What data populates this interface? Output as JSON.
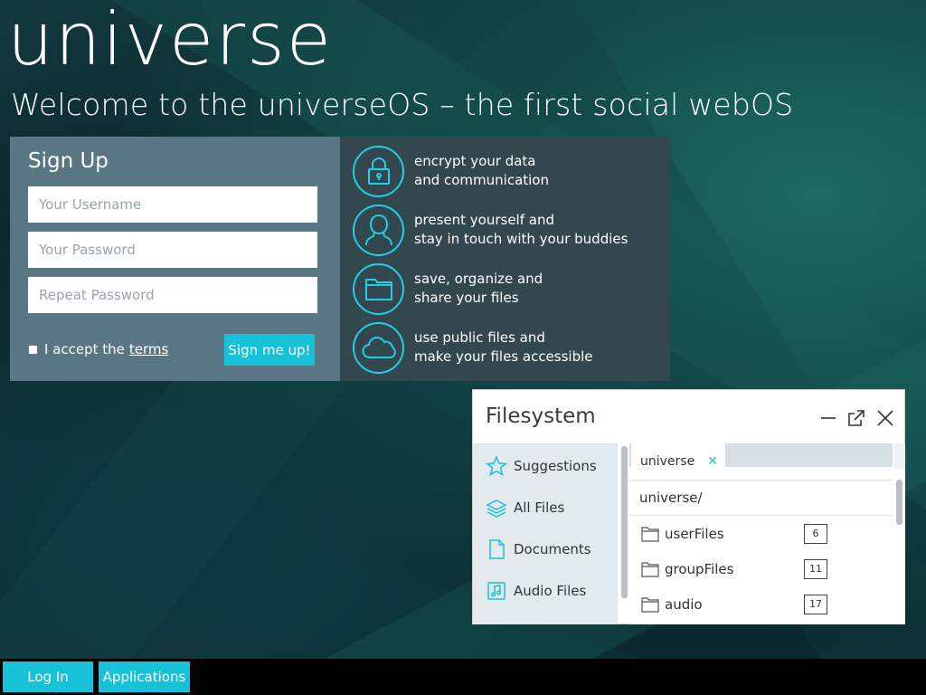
{
  "header": {
    "logo": "universe",
    "tagline": "Welcome to the universeOS – the first social webOS"
  },
  "signup": {
    "title": "Sign Up",
    "username_placeholder": "Your Username",
    "password_placeholder": "Your Password",
    "repeat_placeholder": "Repeat Password",
    "accept_text": "I accept the",
    "terms_link": "terms",
    "submit_label": "Sign me up!"
  },
  "features": [
    {
      "icon": "lock-icon",
      "line1": "encrypt your data",
      "line2": "and communication"
    },
    {
      "icon": "user-icon",
      "line1": "present yourself and",
      "line2": "stay in touch with your buddies"
    },
    {
      "icon": "folder-icon",
      "line1": "save, organize and",
      "line2": "share your files"
    },
    {
      "icon": "cloud-icon",
      "line1": "use public files and",
      "line2": "make your files accessible"
    }
  ],
  "filesystem": {
    "title": "Filesystem",
    "sidebar": [
      {
        "icon": "star-icon",
        "label": "Suggestions"
      },
      {
        "icon": "layers-icon",
        "label": "All Files"
      },
      {
        "icon": "document-icon",
        "label": "Documents"
      },
      {
        "icon": "audio-file-icon",
        "label": "Audio Files"
      }
    ],
    "tab_label": "universe",
    "path": "universe/",
    "rows": [
      {
        "name": "userFiles",
        "count": "6"
      },
      {
        "name": "groupFiles",
        "count": "11"
      },
      {
        "name": "audio",
        "count": "17"
      }
    ]
  },
  "taskbar": {
    "login_label": "Log In",
    "applications_label": "Applications"
  },
  "colors": {
    "accent": "#17c2d8",
    "signup_panel": "#587684",
    "features_panel": "#33474f"
  }
}
